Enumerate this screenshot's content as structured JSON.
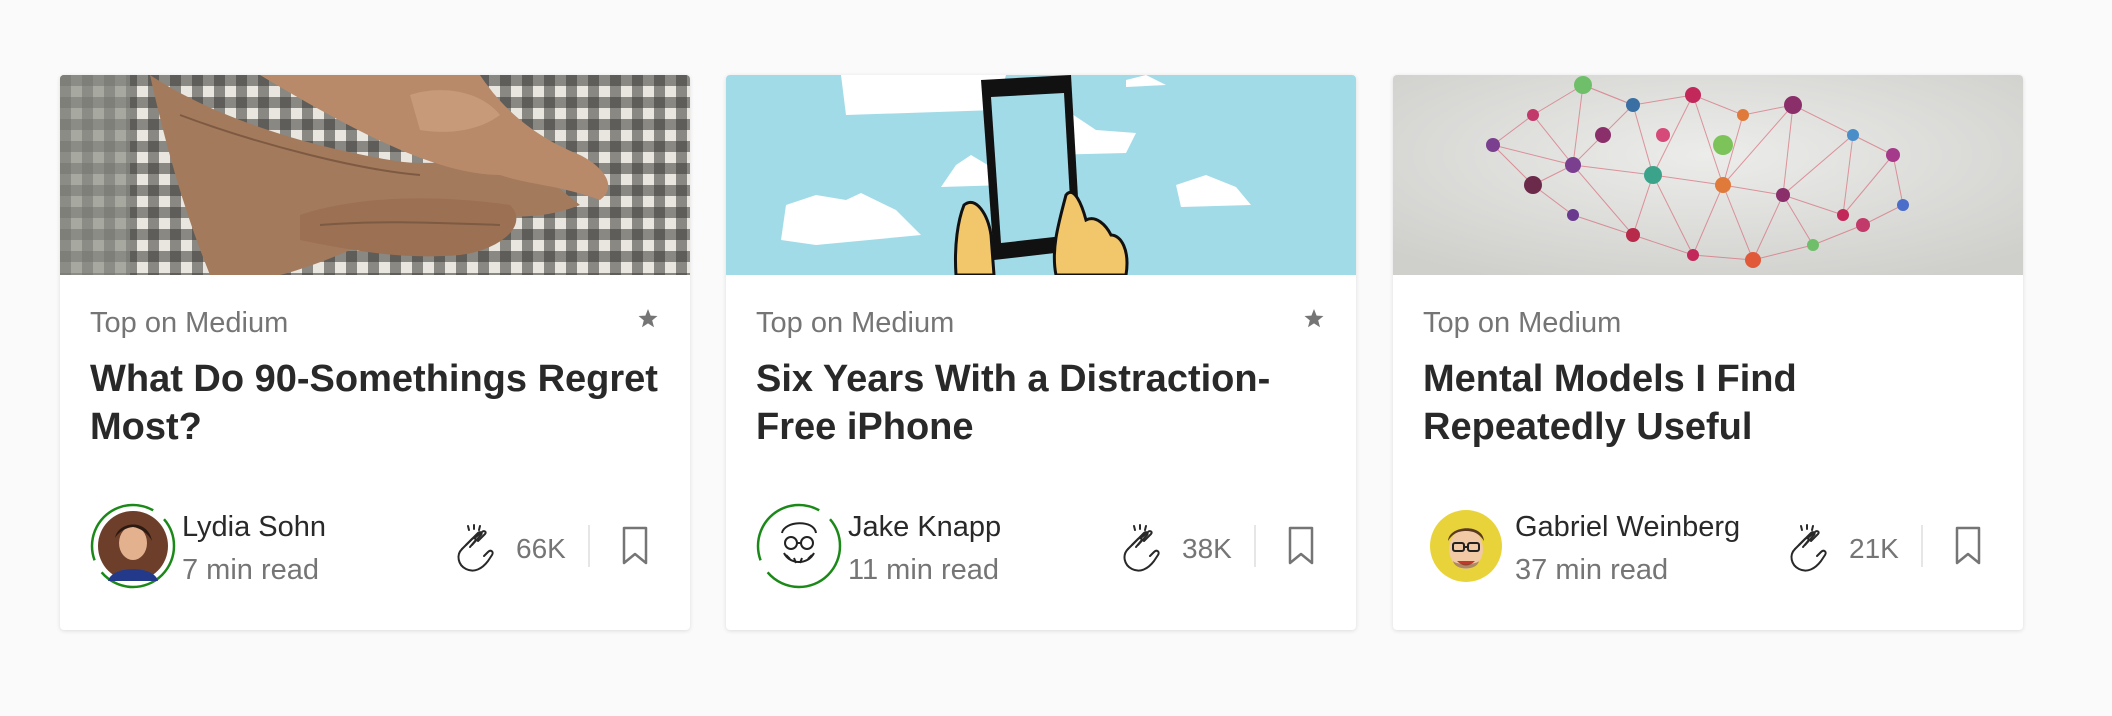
{
  "cards": [
    {
      "kicker": "Top on Medium",
      "title": "What Do 90-Somethings Regret Most?",
      "author": "Lydia Sohn",
      "read_time": "7 min read",
      "claps": "66K",
      "starred": true,
      "image": "elderly-hands-photo",
      "avatar": "photo-avatar",
      "avatar_ring_color": "#1a8917"
    },
    {
      "kicker": "Top on Medium",
      "title": "Six Years With a Distraction-Free iPhone",
      "author": "Jake Knapp",
      "read_time": "11 min read",
      "claps": "38K",
      "starred": true,
      "image": "phone-illustration",
      "avatar": "sketch-avatar",
      "avatar_ring_color": "#1a8917"
    },
    {
      "kicker": "Top on Medium",
      "title": "Mental Models I Find Repeatedly Useful",
      "author": "Gabriel Weinberg",
      "read_time": "37 min read",
      "claps": "21K",
      "starred": false,
      "image": "network-brain-illustration",
      "avatar": "cartoon-avatar",
      "avatar_ring_color": ""
    }
  ],
  "icons": {
    "star": "star-icon",
    "clap": "clap-icon",
    "bookmark": "bookmark-icon"
  },
  "colors": {
    "text_primary": "#292929",
    "text_secondary": "#757575",
    "accent_green": "#1a8917",
    "background": "#fafafa"
  }
}
